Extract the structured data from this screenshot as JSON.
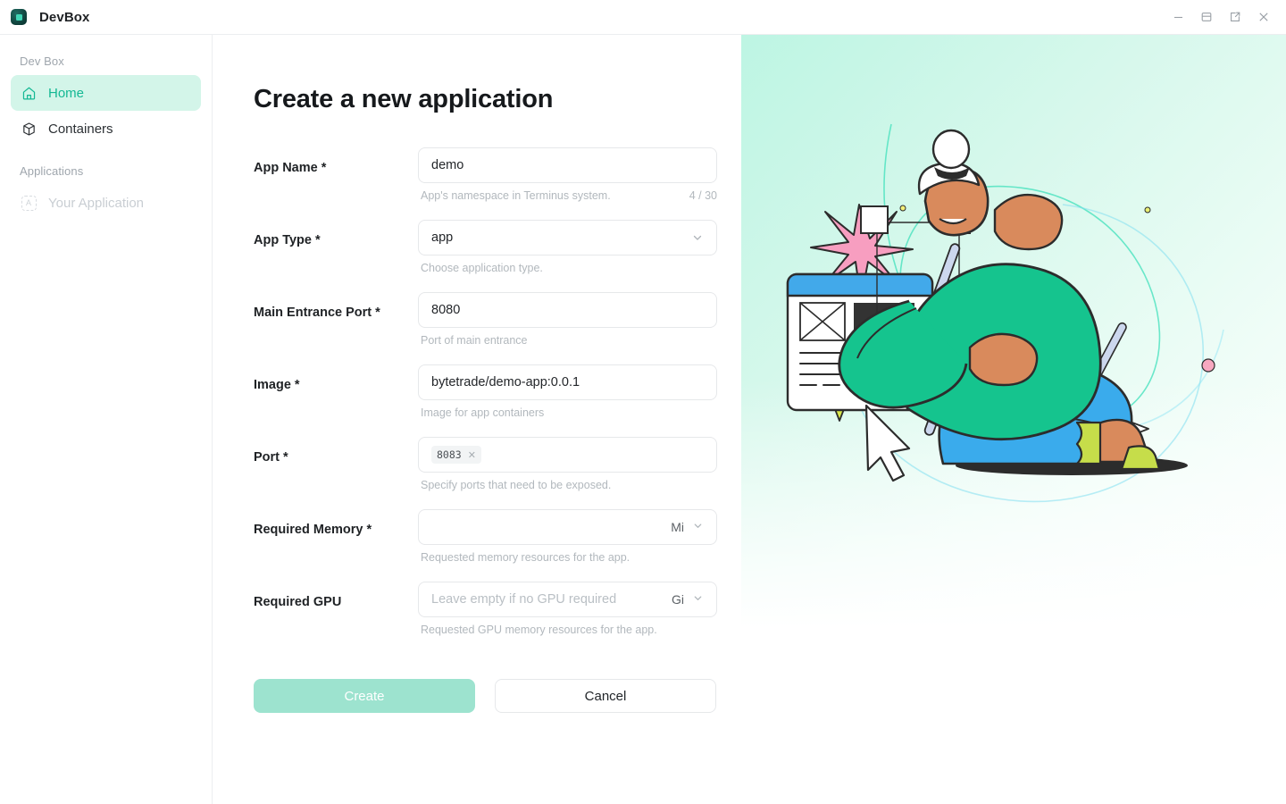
{
  "window": {
    "app_name": "DevBox",
    "logo_icon": "devbox-logo-icon",
    "controls": [
      {
        "name": "minimize-button",
        "icon": "minimize-icon"
      },
      {
        "name": "restore-button",
        "icon": "restore-window-icon"
      },
      {
        "name": "popout-button",
        "icon": "external-link-icon"
      },
      {
        "name": "close-button",
        "icon": "close-icon"
      }
    ]
  },
  "sidebar": {
    "groups": [
      {
        "label": "Dev Box",
        "items": [
          {
            "label": "Home",
            "icon": "home-icon",
            "active": true,
            "disabled": false
          },
          {
            "label": "Containers",
            "icon": "cube-icon",
            "active": false,
            "disabled": false
          }
        ]
      },
      {
        "label": "Applications",
        "items": [
          {
            "label": "Your Application",
            "icon": "app-placeholder-icon",
            "icon_glyph": "A",
            "active": false,
            "disabled": true
          }
        ]
      }
    ]
  },
  "main": {
    "title": "Create a new application",
    "fields": [
      {
        "label": "App Name *",
        "type": "text",
        "value": "demo",
        "placeholder": "",
        "help": "App's namespace in Terminus system.",
        "counter": "4 / 30"
      },
      {
        "label": "App Type *",
        "type": "select",
        "value": "app",
        "placeholder": "",
        "help": "Choose application type.",
        "counter": ""
      },
      {
        "label": "Main Entrance Port *",
        "type": "text",
        "value": "8080",
        "placeholder": "",
        "help": "Port of main entrance",
        "counter": ""
      },
      {
        "label": "Image *",
        "type": "text",
        "value": "bytetrade/demo-app:0.0.1",
        "placeholder": "",
        "help": "Image for app containers",
        "counter": ""
      },
      {
        "label": "Port *",
        "type": "tags",
        "value": "",
        "tags": [
          "8083"
        ],
        "placeholder": "",
        "help": "Specify ports that need to be exposed.",
        "counter": ""
      },
      {
        "label": "Required Memory *",
        "type": "unit",
        "value": "",
        "placeholder": "",
        "unit": "Mi",
        "help": "Requested memory resources for the app.",
        "counter": ""
      },
      {
        "label": "Required GPU",
        "type": "unit",
        "value": "",
        "placeholder": "Leave empty if no GPU required",
        "unit": "Gi",
        "help": "Requested GPU memory resources for the app.",
        "counter": ""
      }
    ],
    "buttons": {
      "create": "Create",
      "cancel": "Cancel"
    }
  },
  "colors": {
    "accent": "#14b894",
    "accent_soft": "#d3f5e9",
    "primary_button": "#9de3cf",
    "hero_gradient_start": "#bdf5e3",
    "hero_gradient_end": "#ffffff",
    "text_primary": "#1f2225",
    "text_muted": "#b2b8bd"
  }
}
